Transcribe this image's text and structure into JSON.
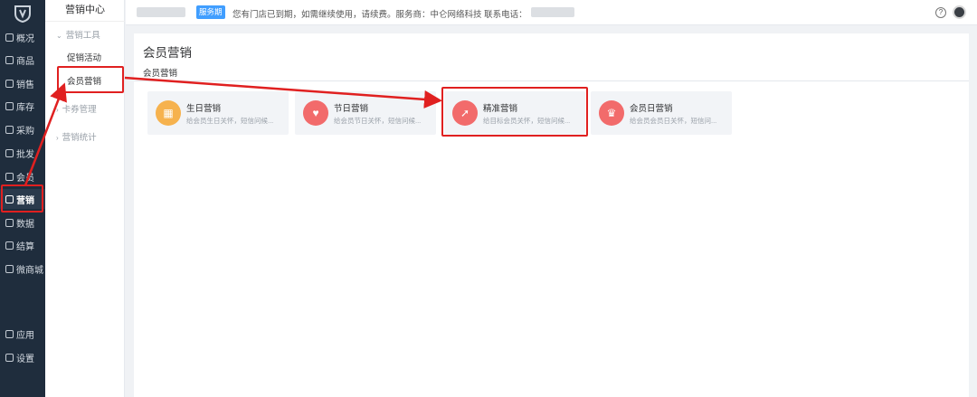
{
  "rail": {
    "items": [
      {
        "label": "概况",
        "icon": "home-icon"
      },
      {
        "label": "商品",
        "icon": "goods-icon"
      },
      {
        "label": "销售",
        "icon": "sales-icon"
      },
      {
        "label": "库存",
        "icon": "inventory-icon"
      },
      {
        "label": "采购",
        "icon": "purchase-icon"
      },
      {
        "label": "批发",
        "icon": "wholesale-icon"
      },
      {
        "label": "会员",
        "icon": "member-icon"
      },
      {
        "label": "营销",
        "icon": "marketing-icon"
      },
      {
        "label": "数据",
        "icon": "data-icon"
      },
      {
        "label": "结算",
        "icon": "settlement-icon"
      },
      {
        "label": "微商城",
        "icon": "microshop-icon"
      },
      {
        "label": "应用",
        "icon": "apps-icon"
      },
      {
        "label": "设置",
        "icon": "settings-icon"
      }
    ]
  },
  "submenu": {
    "title": "营销中心",
    "group_tools": "营销工具",
    "promo": "促销活动",
    "member_marketing": "会员营销",
    "coupon": "卡券管理",
    "stats": "营销统计"
  },
  "topbar": {
    "badge": "服务期",
    "notice": "您有门店已到期，如需继续使用，请续费。服务商：中仑网络科技    联系电话："
  },
  "panel": {
    "title": "会员营销",
    "tab": "会员营销",
    "cards": [
      {
        "title": "生日营销",
        "desc": "给会员生日关怀，短信问候...",
        "color": "#f6b24e",
        "icon": "cake-icon",
        "glyph": "▦"
      },
      {
        "title": "节日营销",
        "desc": "给会员节日关怀，短信问候...",
        "color": "#f26b6b",
        "icon": "balloon-icon",
        "glyph": "♥"
      },
      {
        "title": "精准营销",
        "desc": "给目标会员关怀，短信问候...",
        "color": "#f26b6b",
        "icon": "pin-icon",
        "glyph": "➚"
      },
      {
        "title": "会员日营销",
        "desc": "给会员会员日关怀，短信问...",
        "color": "#f26b6b",
        "icon": "crown-icon",
        "glyph": "♛"
      }
    ]
  },
  "colors": {
    "rail_bg": "#1f2d3d",
    "accent": "#409eff",
    "highlight": "#e02020"
  }
}
